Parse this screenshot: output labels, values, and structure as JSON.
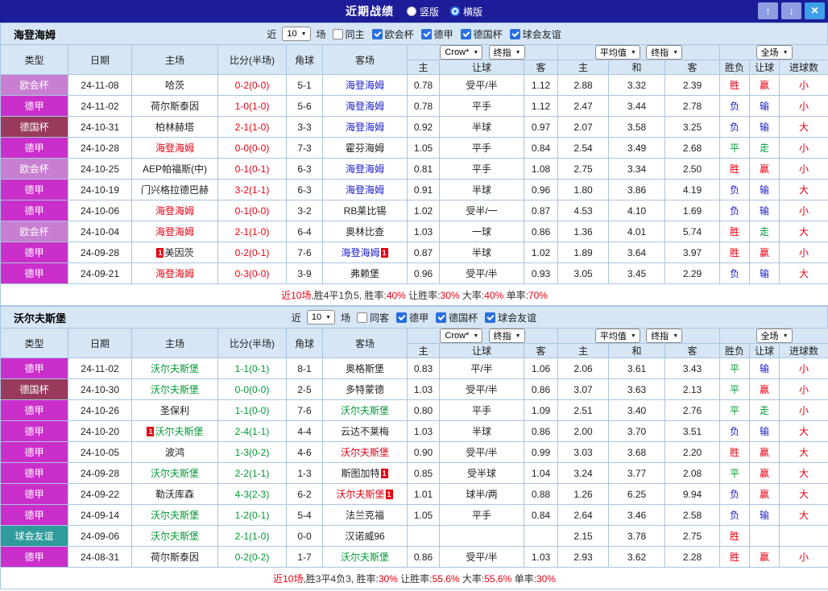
{
  "topbar": {
    "title": "近期战绩",
    "radios": [
      {
        "label": "竖版",
        "checked": false
      },
      {
        "label": "横版",
        "checked": true
      }
    ],
    "buttons": {
      "up": "↑",
      "down": "↓",
      "close": "×"
    }
  },
  "colors": {
    "win": "#e60012",
    "draw": "#009933",
    "loss": "#1a1acc",
    "type_uecl": "#c87fd2",
    "type_bund": "#cb2fcb",
    "type_cup": "#993a5c",
    "type_friendly": "#2f9b9b"
  },
  "tables": [
    {
      "team": "海登海姆",
      "filters": {
        "prefix": "近",
        "count": "10",
        "suffix": "场",
        "checks": [
          {
            "label": "同主",
            "checked": false
          },
          {
            "label": "欧会杯",
            "checked": true
          },
          {
            "label": "德甲",
            "checked": true
          },
          {
            "label": "德国杯",
            "checked": true
          },
          {
            "label": "球会友谊",
            "checked": true
          }
        ]
      },
      "selects": {
        "bookmaker": "Crow*",
        "final1": "终指",
        "average": "平均值",
        "final2": "终指",
        "scope": "全场"
      },
      "columns": [
        "类型",
        "日期",
        "主场",
        "比分(半场)",
        "角球",
        "客场",
        "主",
        "让球",
        "客",
        "主",
        "和",
        "客",
        "胜负",
        "让球",
        "进球数"
      ],
      "score_color": "#e60012",
      "rows": [
        {
          "league": "欧会杯",
          "lc": "uecl",
          "date": "24-11-08",
          "home": {
            "n": "哈茨",
            "c": "k"
          },
          "score": "0-2(0-0)",
          "corner": "5-1",
          "away": {
            "n": "海登海姆",
            "c": "b"
          },
          "odds": [
            "0.78",
            "受平/半",
            "1.12"
          ],
          "avg": [
            "2.88",
            "3.32",
            "2.39"
          ],
          "res": [
            {
              "t": "胜",
              "c": "r"
            },
            {
              "t": "赢",
              "c": "r"
            },
            {
              "t": "小",
              "c": "r"
            }
          ]
        },
        {
          "league": "德甲",
          "lc": "bund",
          "date": "24-11-02",
          "home": {
            "n": "荷尔斯泰因",
            "c": "k"
          },
          "score": "1-0(1-0)",
          "corner": "5-6",
          "away": {
            "n": "海登海姆",
            "c": "b"
          },
          "odds": [
            "0.78",
            "平手",
            "1.12"
          ],
          "avg": [
            "2.47",
            "3.44",
            "2.78"
          ],
          "res": [
            {
              "t": "负",
              "c": "b"
            },
            {
              "t": "输",
              "c": "b"
            },
            {
              "t": "小",
              "c": "r"
            }
          ]
        },
        {
          "league": "德国杯",
          "lc": "cup",
          "date": "24-10-31",
          "home": {
            "n": "柏林赫塔",
            "c": "k"
          },
          "score": "2-1(1-0)",
          "corner": "3-3",
          "away": {
            "n": "海登海姆",
            "c": "b"
          },
          "odds": [
            "0.92",
            "半球",
            "0.97"
          ],
          "avg": [
            "2.07",
            "3.58",
            "3.25"
          ],
          "res": [
            {
              "t": "负",
              "c": "b"
            },
            {
              "t": "输",
              "c": "b"
            },
            {
              "t": "大",
              "c": "r"
            }
          ]
        },
        {
          "league": "德甲",
          "lc": "bund",
          "date": "24-10-28",
          "home": {
            "n": "海登海姆",
            "c": "r"
          },
          "score": "0-0(0-0)",
          "corner": "7-3",
          "away": {
            "n": "霍芬海姆",
            "c": "k"
          },
          "odds": [
            "1.05",
            "平手",
            "0.84"
          ],
          "avg": [
            "2.54",
            "3.49",
            "2.68"
          ],
          "res": [
            {
              "t": "平",
              "c": "g"
            },
            {
              "t": "走",
              "c": "g"
            },
            {
              "t": "小",
              "c": "r"
            }
          ]
        },
        {
          "league": "欧会杯",
          "lc": "uecl",
          "date": "24-10-25",
          "home": {
            "n": "AEP帕福斯(中)",
            "c": "k"
          },
          "score": "0-1(0-1)",
          "corner": "6-3",
          "away": {
            "n": "海登海姆",
            "c": "b"
          },
          "odds": [
            "0.81",
            "平手",
            "1.08"
          ],
          "avg": [
            "2.75",
            "3.34",
            "2.50"
          ],
          "res": [
            {
              "t": "胜",
              "c": "r"
            },
            {
              "t": "赢",
              "c": "r"
            },
            {
              "t": "小",
              "c": "r"
            }
          ]
        },
        {
          "league": "德甲",
          "lc": "bund",
          "date": "24-10-19",
          "home": {
            "n": "门兴格拉德巴赫",
            "c": "k"
          },
          "score": "3-2(1-1)",
          "corner": "6-3",
          "away": {
            "n": "海登海姆",
            "c": "b"
          },
          "odds": [
            "0.91",
            "半球",
            "0.96"
          ],
          "avg": [
            "1.80",
            "3.86",
            "4.19"
          ],
          "res": [
            {
              "t": "负",
              "c": "b"
            },
            {
              "t": "输",
              "c": "b"
            },
            {
              "t": "大",
              "c": "r"
            }
          ]
        },
        {
          "league": "德甲",
          "lc": "bund",
          "date": "24-10-06",
          "home": {
            "n": "海登海姆",
            "c": "r"
          },
          "score": "0-1(0-0)",
          "corner": "3-2",
          "away": {
            "n": "RB莱比锡",
            "c": "k"
          },
          "odds": [
            "1.02",
            "受半/一",
            "0.87"
          ],
          "avg": [
            "4.53",
            "4.10",
            "1.69"
          ],
          "res": [
            {
              "t": "负",
              "c": "b"
            },
            {
              "t": "输",
              "c": "b"
            },
            {
              "t": "小",
              "c": "r"
            }
          ]
        },
        {
          "league": "欧会杯",
          "lc": "uecl",
          "date": "24-10-04",
          "home": {
            "n": "海登海姆",
            "c": "r"
          },
          "score": "2-1(1-0)",
          "corner": "6-4",
          "away": {
            "n": "奥林比查",
            "c": "k"
          },
          "odds": [
            "1.03",
            "一球",
            "0.86"
          ],
          "avg": [
            "1.36",
            "4.01",
            "5.74"
          ],
          "res": [
            {
              "t": "胜",
              "c": "r"
            },
            {
              "t": "走",
              "c": "g"
            },
            {
              "t": "大",
              "c": "r"
            }
          ]
        },
        {
          "league": "德甲",
          "lc": "bund",
          "date": "24-09-28",
          "home": {
            "n": "美因茨",
            "c": "k",
            "rcb": "1"
          },
          "score": "0-2(0-1)",
          "corner": "7-6",
          "away": {
            "n": "海登海姆",
            "c": "b",
            "rca": "1"
          },
          "odds": [
            "0.87",
            "半球",
            "1.02"
          ],
          "avg": [
            "1.89",
            "3.64",
            "3.97"
          ],
          "res": [
            {
              "t": "胜",
              "c": "r"
            },
            {
              "t": "赢",
              "c": "r"
            },
            {
              "t": "小",
              "c": "r"
            }
          ]
        },
        {
          "league": "德甲",
          "lc": "bund",
          "date": "24-09-21",
          "home": {
            "n": "海登海姆",
            "c": "r"
          },
          "score": "0-3(0-0)",
          "corner": "3-9",
          "away": {
            "n": "弗赖堡",
            "c": "k"
          },
          "odds": [
            "0.96",
            "受平/半",
            "0.93"
          ],
          "avg": [
            "3.05",
            "3.45",
            "2.29"
          ],
          "res": [
            {
              "t": "负",
              "c": "b"
            },
            {
              "t": "输",
              "c": "b"
            },
            {
              "t": "大",
              "c": "r"
            }
          ]
        }
      ],
      "summary": [
        {
          "t": "近10场",
          "c": "r"
        },
        {
          "t": ",胜4平1负5, 胜率:",
          "c": "k"
        },
        {
          "t": "40%",
          "c": "r"
        },
        {
          "t": " 让胜率:",
          "c": "k"
        },
        {
          "t": "30%",
          "c": "r"
        },
        {
          "t": " 大率:",
          "c": "k"
        },
        {
          "t": "40%",
          "c": "r"
        },
        {
          "t": " 单率:",
          "c": "k"
        },
        {
          "t": "70%",
          "c": "r"
        }
      ]
    },
    {
      "team": "沃尔夫斯堡",
      "filters": {
        "prefix": "近",
        "count": "10",
        "suffix": "场",
        "checks": [
          {
            "label": "同客",
            "checked": false
          },
          {
            "label": "德甲",
            "checked": true
          },
          {
            "label": "德国杯",
            "checked": true
          },
          {
            "label": "球会友谊",
            "checked": true
          }
        ]
      },
      "selects": {
        "bookmaker": "Crow*",
        "final1": "终指",
        "average": "平均值",
        "final2": "终指",
        "scope": "全场"
      },
      "columns": [
        "类型",
        "日期",
        "主场",
        "比分(半场)",
        "角球",
        "客场",
        "主",
        "让球",
        "客",
        "主",
        "和",
        "客",
        "胜负",
        "让球",
        "进球数"
      ],
      "score_color": "#009933",
      "rows": [
        {
          "league": "德甲",
          "lc": "bund",
          "date": "24-11-02",
          "home": {
            "n": "沃尔夫斯堡",
            "c": "g"
          },
          "score": "1-1(0-1)",
          "corner": "8-1",
          "away": {
            "n": "奥格斯堡",
            "c": "k"
          },
          "odds": [
            "0.83",
            "平/半",
            "1.06"
          ],
          "avg": [
            "2.06",
            "3.61",
            "3.43"
          ],
          "res": [
            {
              "t": "平",
              "c": "g"
            },
            {
              "t": "输",
              "c": "b"
            },
            {
              "t": "小",
              "c": "r"
            }
          ]
        },
        {
          "league": "德国杯",
          "lc": "cup",
          "date": "24-10-30",
          "home": {
            "n": "沃尔夫斯堡",
            "c": "g"
          },
          "score": "0-0(0-0)",
          "corner": "2-5",
          "away": {
            "n": "多特蒙德",
            "c": "k"
          },
          "odds": [
            "1.03",
            "受平/半",
            "0.86"
          ],
          "avg": [
            "3.07",
            "3.63",
            "2.13"
          ],
          "res": [
            {
              "t": "平",
              "c": "g"
            },
            {
              "t": "赢",
              "c": "r"
            },
            {
              "t": "小",
              "c": "r"
            }
          ]
        },
        {
          "league": "德甲",
          "lc": "bund",
          "date": "24-10-26",
          "home": {
            "n": "圣保利",
            "c": "k"
          },
          "score": "1-1(0-0)",
          "corner": "7-6",
          "away": {
            "n": "沃尔夫斯堡",
            "c": "g"
          },
          "odds": [
            "0.80",
            "平手",
            "1.09"
          ],
          "avg": [
            "2.51",
            "3.40",
            "2.76"
          ],
          "res": [
            {
              "t": "平",
              "c": "g"
            },
            {
              "t": "走",
              "c": "g"
            },
            {
              "t": "小",
              "c": "r"
            }
          ]
        },
        {
          "league": "德甲",
          "lc": "bund",
          "date": "24-10-20",
          "home": {
            "n": "沃尔夫斯堡",
            "c": "g",
            "rcb": "1"
          },
          "score": "2-4(1-1)",
          "corner": "4-4",
          "away": {
            "n": "云达不莱梅",
            "c": "k"
          },
          "odds": [
            "1.03",
            "半球",
            "0.86"
          ],
          "avg": [
            "2.00",
            "3.70",
            "3.51"
          ],
          "res": [
            {
              "t": "负",
              "c": "b"
            },
            {
              "t": "输",
              "c": "b"
            },
            {
              "t": "大",
              "c": "r"
            }
          ]
        },
        {
          "league": "德甲",
          "lc": "bund",
          "date": "24-10-05",
          "home": {
            "n": "波鸿",
            "c": "k"
          },
          "score": "1-3(0-2)",
          "corner": "4-6",
          "away": {
            "n": "沃尔夫斯堡",
            "c": "r"
          },
          "odds": [
            "0.90",
            "受平/半",
            "0.99"
          ],
          "avg": [
            "3.03",
            "3.68",
            "2.20"
          ],
          "res": [
            {
              "t": "胜",
              "c": "r"
            },
            {
              "t": "赢",
              "c": "r"
            },
            {
              "t": "大",
              "c": "r"
            }
          ]
        },
        {
          "league": "德甲",
          "lc": "bund",
          "date": "24-09-28",
          "home": {
            "n": "沃尔夫斯堡",
            "c": "g"
          },
          "score": "2-2(1-1)",
          "corner": "1-3",
          "away": {
            "n": "斯图加特",
            "c": "k",
            "rca": "1"
          },
          "odds": [
            "0.85",
            "受半球",
            "1.04"
          ],
          "avg": [
            "3.24",
            "3.77",
            "2.08"
          ],
          "res": [
            {
              "t": "平",
              "c": "g"
            },
            {
              "t": "赢",
              "c": "r"
            },
            {
              "t": "大",
              "c": "r"
            }
          ]
        },
        {
          "league": "德甲",
          "lc": "bund",
          "date": "24-09-22",
          "home": {
            "n": "勒沃库森",
            "c": "k"
          },
          "score": "4-3(2-3)",
          "corner": "6-2",
          "away": {
            "n": "沃尔夫斯堡",
            "c": "r",
            "rca": "1"
          },
          "odds": [
            "1.01",
            "球半/两",
            "0.88"
          ],
          "avg": [
            "1.26",
            "6.25",
            "9.94"
          ],
          "res": [
            {
              "t": "负",
              "c": "b"
            },
            {
              "t": "赢",
              "c": "r"
            },
            {
              "t": "大",
              "c": "r"
            }
          ]
        },
        {
          "league": "德甲",
          "lc": "bund",
          "date": "24-09-14",
          "home": {
            "n": "沃尔夫斯堡",
            "c": "g"
          },
          "score": "1-2(0-1)",
          "corner": "5-4",
          "away": {
            "n": "法兰克福",
            "c": "k"
          },
          "odds": [
            "1.05",
            "平手",
            "0.84"
          ],
          "avg": [
            "2.64",
            "3.46",
            "2.58"
          ],
          "res": [
            {
              "t": "负",
              "c": "b"
            },
            {
              "t": "输",
              "c": "b"
            },
            {
              "t": "大",
              "c": "r"
            }
          ]
        },
        {
          "league": "球会友谊",
          "lc": "friendly",
          "date": "24-09-06",
          "home": {
            "n": "沃尔夫斯堡",
            "c": "g"
          },
          "score": "2-1(1-0)",
          "corner": "0-0",
          "away": {
            "n": "汉诺威96",
            "c": "k"
          },
          "odds": [
            "",
            "",
            ""
          ],
          "avg": [
            "2.15",
            "3.78",
            "2.75"
          ],
          "res": [
            {
              "t": "胜",
              "c": "r"
            },
            {
              "t": "",
              "c": "k"
            },
            {
              "t": "",
              "c": "k"
            }
          ]
        },
        {
          "league": "德甲",
          "lc": "bund",
          "date": "24-08-31",
          "home": {
            "n": "荷尔斯泰因",
            "c": "k"
          },
          "score": "0-2(0-2)",
          "corner": "1-7",
          "away": {
            "n": "沃尔夫斯堡",
            "c": "g"
          },
          "odds": [
            "0.86",
            "受平/半",
            "1.03"
          ],
          "avg": [
            "2.93",
            "3.62",
            "2.28"
          ],
          "res": [
            {
              "t": "胜",
              "c": "r"
            },
            {
              "t": "赢",
              "c": "r"
            },
            {
              "t": "小",
              "c": "r"
            }
          ]
        }
      ],
      "summary": [
        {
          "t": "近10场",
          "c": "r"
        },
        {
          "t": ",胜3平4负3, 胜率:",
          "c": "k"
        },
        {
          "t": "30%",
          "c": "r"
        },
        {
          "t": " 让胜率:",
          "c": "k"
        },
        {
          "t": "55.6%",
          "c": "r"
        },
        {
          "t": " 大率:",
          "c": "k"
        },
        {
          "t": "55.6%",
          "c": "r"
        },
        {
          "t": " 单率:",
          "c": "k"
        },
        {
          "t": "30%",
          "c": "r"
        }
      ]
    }
  ]
}
